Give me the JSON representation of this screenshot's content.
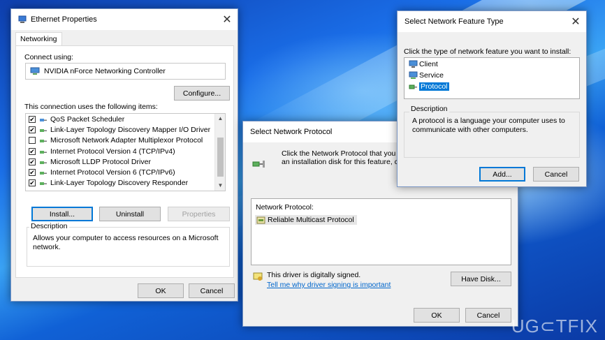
{
  "eth": {
    "title": "Ethernet Properties",
    "tab": "Networking",
    "connect_using": "Connect using:",
    "adapter": "NVIDIA nForce Networking Controller",
    "configure": "Configure...",
    "items_label": "This connection uses the following items:",
    "items": [
      {
        "label": "QoS Packet Scheduler",
        "checked": true
      },
      {
        "label": "Link-Layer Topology Discovery Mapper I/O Driver",
        "checked": true
      },
      {
        "label": "Microsoft Network Adapter Multiplexor Protocol",
        "checked": false
      },
      {
        "label": "Internet Protocol Version 4 (TCP/IPv4)",
        "checked": true
      },
      {
        "label": "Microsoft LLDP Protocol Driver",
        "checked": true
      },
      {
        "label": "Internet Protocol Version 6 (TCP/IPv6)",
        "checked": true
      },
      {
        "label": "Link-Layer Topology Discovery Responder",
        "checked": true
      }
    ],
    "install": "Install...",
    "uninstall": "Uninstall",
    "properties": "Properties",
    "description_title": "Description",
    "description": "Allows your computer to access resources on a Microsoft network.",
    "ok": "OK",
    "cancel": "Cancel"
  },
  "snp": {
    "title": "Select Network Protocol",
    "instructions": "Click the Network Protocol that you wa",
    "instructions2": "an installation disk for this feature, click",
    "list_label": "Network Protocol:",
    "protocol": "Reliable Multicast Protocol",
    "signed": "This driver is digitally signed.",
    "signing_link": "Tell me why driver signing is important",
    "have_disk": "Have Disk...",
    "ok": "OK",
    "cancel": "Cancel"
  },
  "snft": {
    "title": "Select Network Feature Type",
    "prompt": "Click the type of network feature you want to install:",
    "features": [
      "Client",
      "Service",
      "Protocol"
    ],
    "selected": "Protocol",
    "description_title": "Description",
    "description": "A protocol is a language your computer uses to communicate with other computers.",
    "add": "Add...",
    "cancel": "Cancel"
  },
  "watermark": "UG⊂TFIX",
  "colors": {
    "accent": "#0078d7",
    "link": "#0066cc"
  }
}
